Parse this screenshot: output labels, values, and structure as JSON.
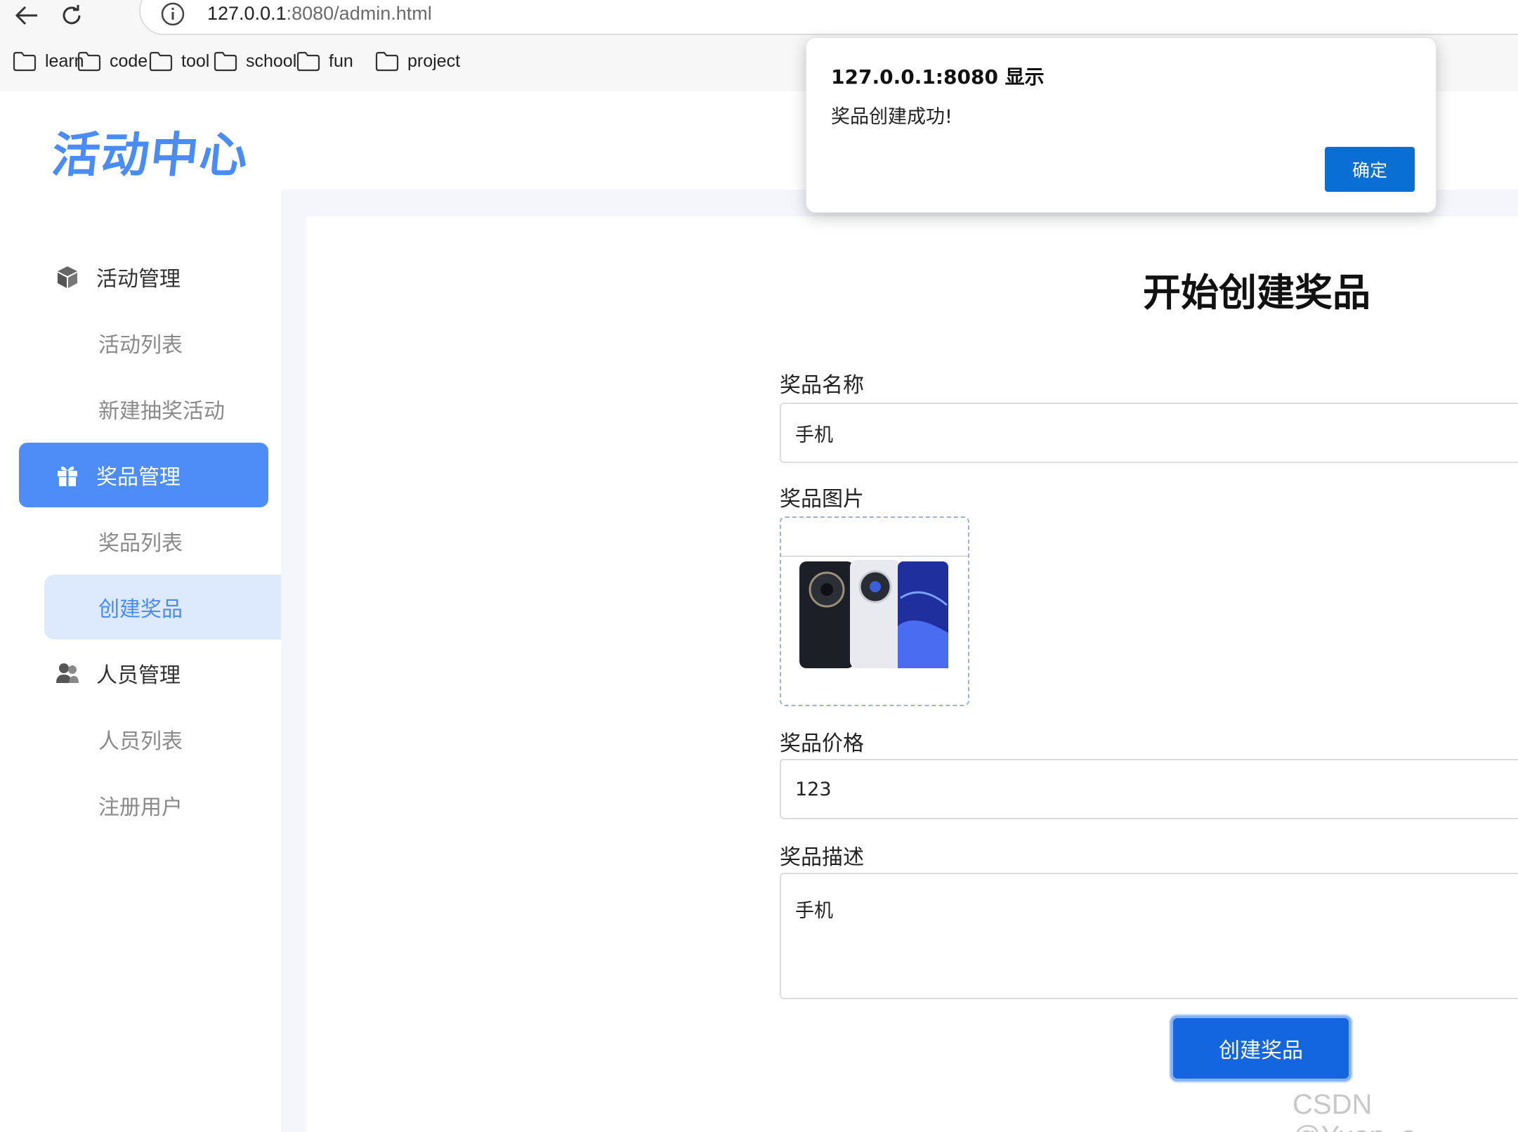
{
  "browser": {
    "url_host": "127.0.0.1",
    "url_rest": ":8080/admin.html",
    "bookmarks": [
      "learn",
      "code",
      "tool",
      "school",
      "fun",
      "project"
    ]
  },
  "app": {
    "logo": "活动中心",
    "accent_color": "#4e8cf8",
    "sidebar": {
      "activity_group": "活动管理",
      "activity_list": "活动列表",
      "new_lottery": "新建抽奖活动",
      "prize_group": "奖品管理",
      "prize_list": "奖品列表",
      "create_prize": "创建奖品",
      "user_group": "人员管理",
      "user_list": "人员列表",
      "register_user": "注册用户"
    },
    "form": {
      "title": "开始创建奖品",
      "name_label": "奖品名称",
      "name_value": "手机",
      "image_label": "奖品图片",
      "price_label": "奖品价格",
      "price_value": "123",
      "desc_label": "奖品描述",
      "desc_value": "手机",
      "submit_label": "创建奖品"
    }
  },
  "dialog": {
    "title": "127.0.0.1:8080 显示",
    "message": "奖品创建成功!",
    "ok_label": "确定"
  },
  "watermark": "CSDN @Yuan_o_"
}
